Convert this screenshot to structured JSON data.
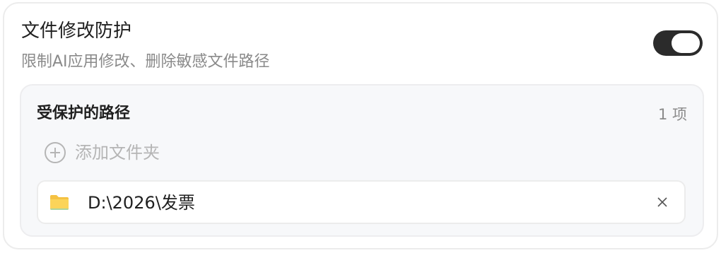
{
  "setting": {
    "title": "文件修改防护",
    "subtitle": "限制AI应用修改、删除敏感文件路径",
    "enabled": true
  },
  "protected_paths": {
    "title": "受保护的路径",
    "count_label": "1 项",
    "add_label": "添加文件夹",
    "items": [
      {
        "path": "D:\\2026\\发票",
        "icon": "folder-icon"
      }
    ]
  },
  "colors": {
    "toggle_on": "#2b2b2b",
    "folder": "#f5c242"
  }
}
